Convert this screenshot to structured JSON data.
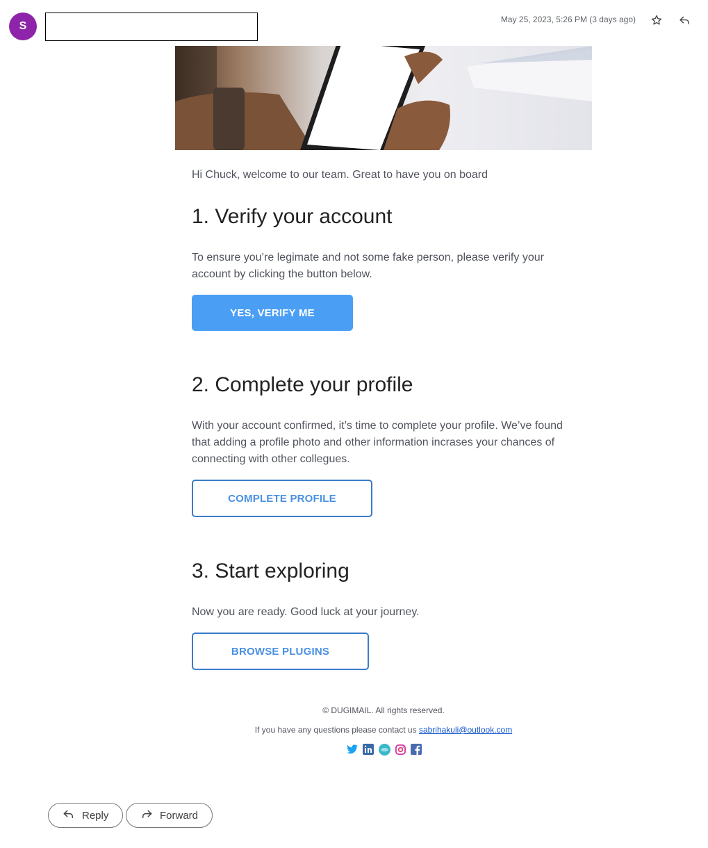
{
  "header": {
    "avatar_letter": "S",
    "timestamp": "May 25, 2023, 5:26 PM (3 days ago)"
  },
  "email": {
    "greeting": "Hi Chuck, welcome to our team. Great to have you on board",
    "step1": {
      "title": "1. Verify your account",
      "text": "To ensure you’re legimate and not some fake person, please verify your account by clicking the button below.",
      "button": "YES, VERIFY ME"
    },
    "step2": {
      "title": "2. Complete your profile",
      "text": "With your account confirmed, it’s time to complete your profile. We’ve found that adding a profile photo and other information incrases your chances of connecting with other collegues.",
      "button": "COMPLETE PROFILE"
    },
    "step3": {
      "title": "3. Start exploring",
      "text": "Now you are ready. Good luck at your journey.",
      "button": "BROWSE PLUGINS"
    },
    "footer": {
      "copyright": "© DUGIMAIL. All rights reserved.",
      "contact_prefix": "If you have any questions please contact us",
      "contact_email": "sabrihakuli@outlook.com"
    },
    "social_icons": [
      "twitter-icon",
      "linkedin-icon",
      "web-icon",
      "instagram-icon",
      "facebook-icon"
    ]
  },
  "actions": {
    "reply_label": "Reply",
    "forward_label": "Forward"
  },
  "colors": {
    "avatar": "#8e24aa",
    "primary_button": "#4a9ff5",
    "outline_button": "#3a7cc8",
    "link": "#1155cc"
  }
}
